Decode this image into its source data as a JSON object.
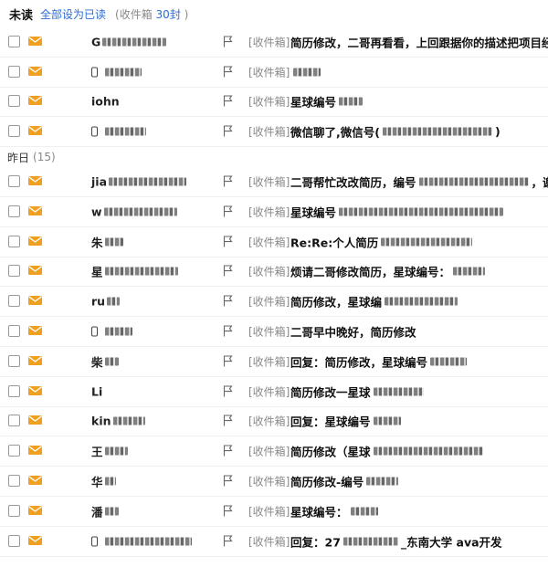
{
  "header": {
    "title": "未读",
    "mark_all_read": "全部设为已读",
    "inbox_label": "(收件箱",
    "inbox_count": "30封",
    "inbox_close": ")"
  },
  "group_yesterday": {
    "label": "昨日",
    "count": "(15)"
  },
  "mail_tag": "[收件箱]",
  "unread_rows": [
    {
      "sender": "G",
      "subject": "简历修改，二哥再看看，上回跟据你的描述把项目经",
      "subject_tail": ""
    },
    {
      "sender": "",
      "subject": "",
      "subject_tail": ""
    },
    {
      "sender": "iohn",
      "subject": "星球编号",
      "subject_tail": ""
    },
    {
      "sender": "",
      "subject": "微信聊了,微信号(",
      "subject_tail": ")"
    }
  ],
  "yesterday_rows": [
    {
      "sender": "jia",
      "subject": "二哥帮忙改改简历，编号",
      "subject_tail": "，谢谢了"
    },
    {
      "sender": "w",
      "subject": "星球编号",
      "subject_tail": ""
    },
    {
      "sender": "朱",
      "subject": "Re:Re:个人简历",
      "subject_tail": ""
    },
    {
      "sender": "星",
      "subject": "烦请二哥修改简历，星球编号：",
      "subject_tail": ""
    },
    {
      "sender": "ru",
      "subject": "简历修改，星球编",
      "subject_tail": ""
    },
    {
      "sender": "",
      "subject": "二哥早中晚好，简历修改",
      "subject_tail": ""
    },
    {
      "sender": "柴",
      "subject": "回复：简历修改，星球编号",
      "subject_tail": ""
    },
    {
      "sender": "Li",
      "subject": "简历修改一星球",
      "subject_tail": ""
    },
    {
      "sender": "kin",
      "subject": "回复：星球编号",
      "subject_tail": ""
    },
    {
      "sender": "王",
      "subject": "简历修改（星球",
      "subject_tail": ""
    },
    {
      "sender": "华",
      "subject": "简历修改-编号",
      "subject_tail": ""
    },
    {
      "sender": "潘",
      "subject": "星球编号：",
      "subject_tail": ""
    },
    {
      "sender": "",
      "subject": "回复：27",
      "subject_tail": "_东南大学 ava开发"
    }
  ],
  "colors": {
    "accent_blue": "#2a6cd6",
    "envelope": "#f0a020",
    "muted": "#888888"
  },
  "icons": {
    "checkbox": "checkbox-icon",
    "envelope": "envelope-icon",
    "flag": "flag-icon",
    "phone": "phone-icon"
  }
}
